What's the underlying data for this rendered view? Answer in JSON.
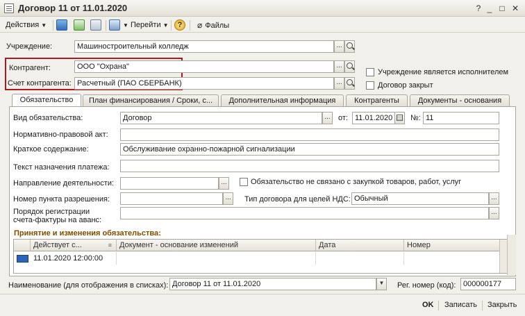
{
  "window": {
    "title": "Договор 11 от 11.01.2020",
    "help_label": "?",
    "min_label": "_",
    "max_label": "□",
    "close_label": "✕"
  },
  "toolbar": {
    "actions_label": "Действия",
    "goto_label": "Перейти",
    "help_label": "?",
    "files_label": "Файлы"
  },
  "form": {
    "institution_label": "Учреждение:",
    "institution_value": "Машиностроительный колледж",
    "counterparty_label": "Контрагент:",
    "counterparty_value": "ООО \"Охрана\"",
    "account_label": "Счет контрагента:",
    "account_value": "Расчетный (ПАО СБЕРБАНК)",
    "is_executor_label": "Учреждение является исполнителем",
    "contract_closed_label": "Договор закрыт",
    "select_btn": "..."
  },
  "tabs": [
    {
      "label": "Обязательство"
    },
    {
      "label": "План финансирования / Сроки, с..."
    },
    {
      "label": "Дополнительная информация"
    },
    {
      "label": "Контрагенты"
    },
    {
      "label": "Документы - основания"
    }
  ],
  "obligation": {
    "type_label": "Вид обязательства:",
    "type_value": "Договор",
    "date_label": "от:",
    "date_value": "11.01.2020",
    "number_label": "№:",
    "number_value": "11",
    "normative_label": "Нормативно-правовой акт:",
    "normative_value": "",
    "summary_label": "Краткое содержание:",
    "summary_value": "Обслуживание охранно-пожарной сигнализации",
    "payment_text_label": "Текст назначения платежа:",
    "payment_text_value": "",
    "direction_label": "Направление деятельности:",
    "direction_value": "",
    "not_procurement_label": "Обязательство не связано с закупкой товаров, работ, услуг",
    "permit_label": "Номер пункта разрешения:",
    "permit_value": "",
    "vat_label": "Тип договора для целей НДС:",
    "vat_value": "Обычный",
    "invoice_label_1": "Порядок регистрации",
    "invoice_label_2": "счета-фактуры на аванс:",
    "invoice_value": ""
  },
  "changes": {
    "title": "Принятие и изменения обязательства:",
    "columns": [
      "Действует с...",
      "Документ - основание изменений",
      "Дата",
      "Номер"
    ],
    "rows": [
      {
        "valid_from": "11.01.2020 12:00:00",
        "document": "",
        "date": "",
        "number": ""
      }
    ]
  },
  "bottom": {
    "name_label": "Наименование (для отображения в списках):",
    "name_value": "Договор 11 от 11.01.2020",
    "reg_label": "Рег. номер (код):",
    "reg_value": "000000177"
  },
  "footer": {
    "ok_label": "OK",
    "save_label": "Записать",
    "close_label": "Закрыть"
  }
}
